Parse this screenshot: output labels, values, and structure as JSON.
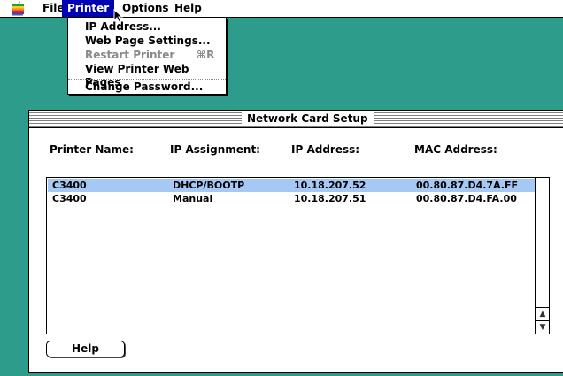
{
  "menubar": {
    "items": [
      {
        "label": "File"
      },
      {
        "label": "Printer"
      },
      {
        "label": "Options"
      },
      {
        "label": "Help"
      }
    ]
  },
  "printer_menu": {
    "items": [
      {
        "label": "IP Address..."
      },
      {
        "label": "Web Page Settings..."
      },
      {
        "label": "Restart Printer",
        "shortcut": "⌘R"
      },
      {
        "label": "View Printer Web Pages"
      },
      {
        "label": "Change Password..."
      }
    ]
  },
  "window": {
    "title": "Network Card Setup",
    "columns": [
      "Printer Name:",
      "IP Assignment:",
      "IP Address:",
      "MAC Address:"
    ],
    "rows": [
      {
        "name": "C3400",
        "assignment": "DHCP/BOOTP",
        "ip": "10.18.207.52",
        "mac": "00.80.87.D4.7A.FF"
      },
      {
        "name": "C3400",
        "assignment": "Manual",
        "ip": "10.18.207.51",
        "mac": "00.80.87.D4.FA.00"
      }
    ],
    "help_button": "Help"
  },
  "colors": {
    "desktop": "#2e9c8a",
    "menu_highlight": "#0000b5",
    "row_selected": "#a5c8f4"
  }
}
